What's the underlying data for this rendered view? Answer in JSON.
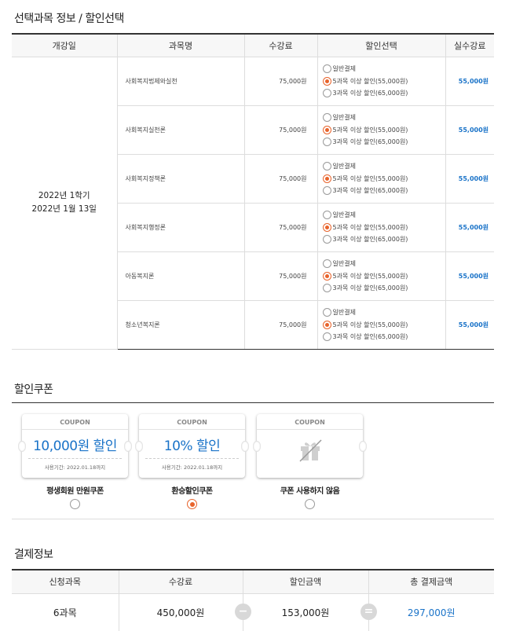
{
  "selected_section": {
    "title": "선택과목 정보 / 할인선택",
    "columns": [
      "개강일",
      "과목명",
      "수강료",
      "할인선택",
      "실수강료"
    ],
    "start_date": [
      "2022년 1학기",
      "2022년 1월 13일"
    ],
    "option_labels": [
      "일반결제",
      "5과목 이상 할인(55,000원)",
      "3과목 이상 할인(65,000원)"
    ],
    "rows": [
      {
        "name": "사회복지법제와실천",
        "fee": "75,000원",
        "real_fee": "55,000원",
        "selected_option": 1
      },
      {
        "name": "사회복지실천론",
        "fee": "75,000원",
        "real_fee": "55,000원",
        "selected_option": 1
      },
      {
        "name": "사회복지정책론",
        "fee": "75,000원",
        "real_fee": "55,000원",
        "selected_option": 1
      },
      {
        "name": "사회복지행정론",
        "fee": "75,000원",
        "real_fee": "55,000원",
        "selected_option": 1
      },
      {
        "name": "아동복지론",
        "fee": "75,000원",
        "real_fee": "55,000원",
        "selected_option": 1
      },
      {
        "name": "청소년복지론",
        "fee": "75,000원",
        "real_fee": "55,000원",
        "selected_option": 1
      }
    ]
  },
  "coupon_section": {
    "title": "할인쿠폰",
    "coupons": [
      {
        "head": "COUPON",
        "amount": "10,000원 할인",
        "period": "사용기간: 2022.01.18까지",
        "label": "평생회원 만원쿠폰",
        "selected": false
      },
      {
        "head": "COUPON",
        "amount": "10% 할인",
        "period": "사용기간: 2022.01.18까지",
        "label": "환승할인쿠폰",
        "selected": true
      },
      {
        "head": "COUPON",
        "label": "쿠폰 사용하지 않음",
        "selected": false,
        "icon": "gift-crossed-icon"
      }
    ]
  },
  "payment_section": {
    "title": "결제정보",
    "columns": [
      "신청과목",
      "수강료",
      "할인금액",
      "총 결제금액"
    ],
    "subject_count": "6과목",
    "tuition": "450,000원",
    "discount": "153,000원",
    "total": "297,000원",
    "minus_sign": "−",
    "equals_sign": "="
  },
  "colors": {
    "accent_blue": "#1a73c8",
    "radio_orange": "#e8632b"
  }
}
